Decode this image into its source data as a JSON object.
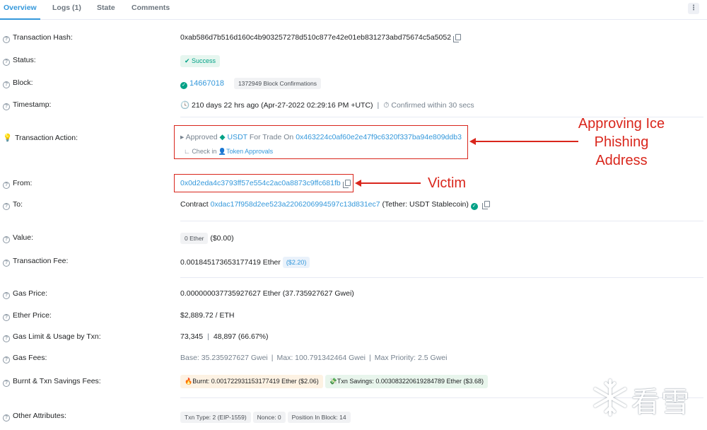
{
  "tabs": [
    "Overview",
    "Logs (1)",
    "State",
    "Comments"
  ],
  "more_label": "⋮",
  "labels": {
    "tx_hash": "Transaction Hash:",
    "status": "Status:",
    "block": "Block:",
    "timestamp": "Timestamp:",
    "tx_action": "Transaction Action:",
    "from": "From:",
    "to": "To:",
    "value": "Value:",
    "tx_fee": "Transaction Fee:",
    "gas_price": "Gas Price:",
    "ether_price": "Ether Price:",
    "gas_limit": "Gas Limit & Usage by Txn:",
    "gas_fees": "Gas Fees:",
    "burnt_fees": "Burnt & Txn Savings Fees:",
    "other_attrs": "Other Attributes:"
  },
  "tx_hash": "0xab586d7b516d160c4b903257278d510c877e42e01eb831273abd75674c5a5052",
  "status": "Success",
  "block": {
    "number": "14667018",
    "confirmations": "1372949 Block Confirmations"
  },
  "timestamp": {
    "text": "210 days 22 hrs ago (Apr-27-2022 02:29:16 PM +UTC)",
    "confirmed": "Confirmed within 30 secs"
  },
  "action": {
    "prefix": "▸ Approved",
    "token": "USDT",
    "middle": "For Trade On",
    "address": "0x463224c0af60e2e47f9c6320f337ba94e809ddb3",
    "check_in": "Check in",
    "approvals": "Token Approvals"
  },
  "from": "0x0d2eda4c3793ff57e554c2ac0a8873c9ffc681fb",
  "to": {
    "prefix": "Contract",
    "address": "0xdac17f958d2ee523a2206206994597c13d831ec7",
    "name": "(Tether: USDT Stablecoin)"
  },
  "value": {
    "chip": "0 Ether",
    "usd": "($0.00)"
  },
  "tx_fee": {
    "amount": "0.001845173653177419 Ether",
    "usd": "($2.20)"
  },
  "gas_price": "0.000000037735927627 Ether (37.735927627 Gwei)",
  "ether_price": "$2,889.72 / ETH",
  "gas_limit": {
    "limit": "73,345",
    "usage": "48,897 (66.67%)"
  },
  "gas_fees": {
    "base": "Base: 35.235927627 Gwei",
    "max": "Max: 100.791342464 Gwei",
    "priority": "Max Priority: 2.5 Gwei"
  },
  "burnt": {
    "burnt": "Burnt: 0.001722931153177419 Ether ($2.06)",
    "savings": "Txn Savings: 0.003083220619284789 Ether ($3.68)"
  },
  "other": {
    "txn_type": "Txn Type: 2 (EIP-1559)",
    "nonce": "Nonce: 0",
    "position": "Position In Block: 14"
  },
  "annotations": {
    "approving": [
      "Approving Ice",
      "Phishing",
      "Address"
    ],
    "victim": "Victim"
  },
  "watermark": "看雪",
  "colors": {
    "link": "#3498db",
    "success": "#00a186",
    "annotation": "#d9261c"
  }
}
